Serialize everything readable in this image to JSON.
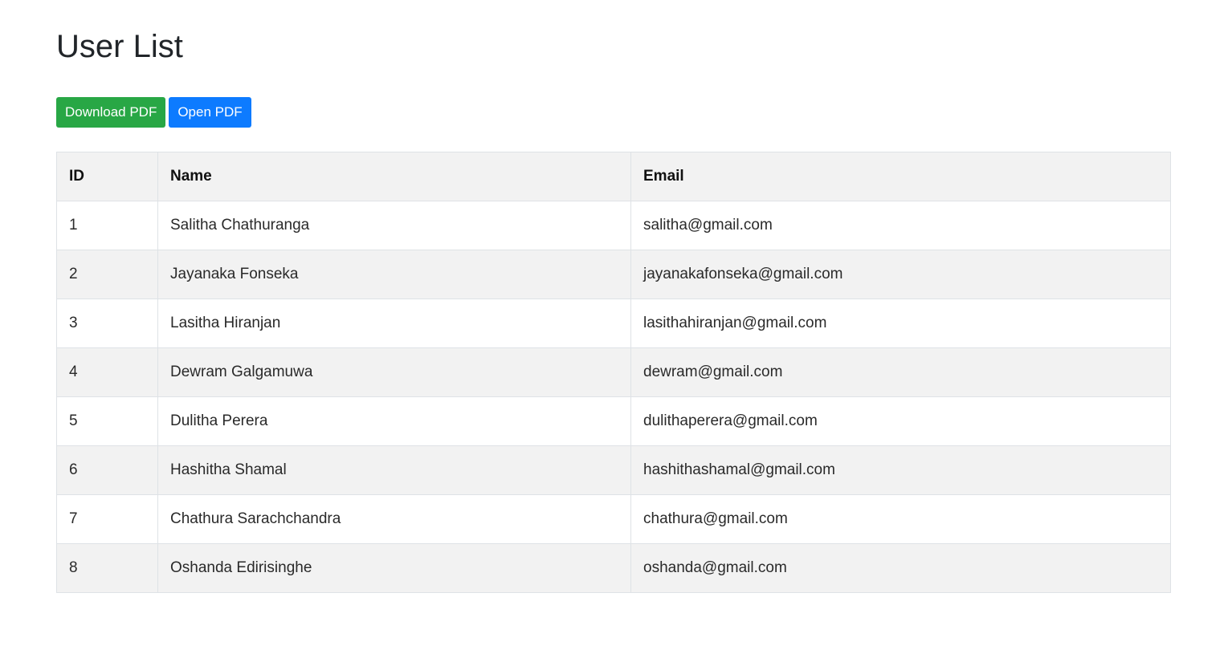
{
  "page": {
    "title": "User List"
  },
  "actions": {
    "download_label": "Download PDF",
    "open_label": "Open PDF"
  },
  "colors": {
    "download_button": "#28a745",
    "open_button": "#0d7bff",
    "header_bg": "#f2f2f2",
    "striped_row_bg": "#f2f2f2",
    "border": "#dee2e6"
  },
  "table": {
    "columns": [
      "ID",
      "Name",
      "Email"
    ],
    "rows": [
      {
        "id": "1",
        "name": "Salitha Chathuranga",
        "email": "salitha@gmail.com"
      },
      {
        "id": "2",
        "name": "Jayanaka Fonseka",
        "email": "jayanakafonseka@gmail.com"
      },
      {
        "id": "3",
        "name": "Lasitha Hiranjan",
        "email": "lasithahiranjan@gmail.com"
      },
      {
        "id": "4",
        "name": "Dewram Galgamuwa",
        "email": "dewram@gmail.com"
      },
      {
        "id": "5",
        "name": "Dulitha Perera",
        "email": "dulithaperera@gmail.com"
      },
      {
        "id": "6",
        "name": "Hashitha Shamal",
        "email": "hashithashamal@gmail.com"
      },
      {
        "id": "7",
        "name": "Chathura Sarachchandra",
        "email": "chathura@gmail.com"
      },
      {
        "id": "8",
        "name": "Oshanda Edirisinghe",
        "email": "oshanda@gmail.com"
      }
    ]
  }
}
